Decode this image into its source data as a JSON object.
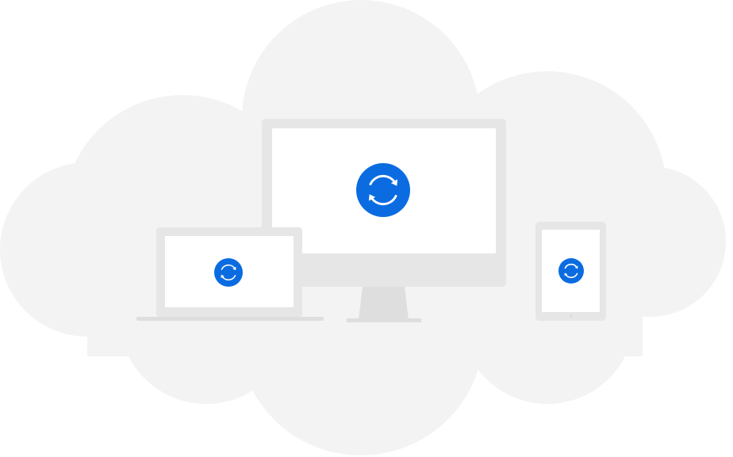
{
  "colors": {
    "background": "#ffffff",
    "cloud": "#f3f3f3",
    "device_frame": "#e6e6e6",
    "device_base": "#dedede",
    "screen": "#ffffff",
    "sync_badge": "#0a6ce0",
    "sync_glyph": "#ffffff"
  },
  "icons": {
    "cloud": "cloud-shape",
    "sync": "sync-arrows-icon",
    "desktop": "desktop-monitor",
    "laptop": "laptop",
    "tablet": "tablet"
  }
}
